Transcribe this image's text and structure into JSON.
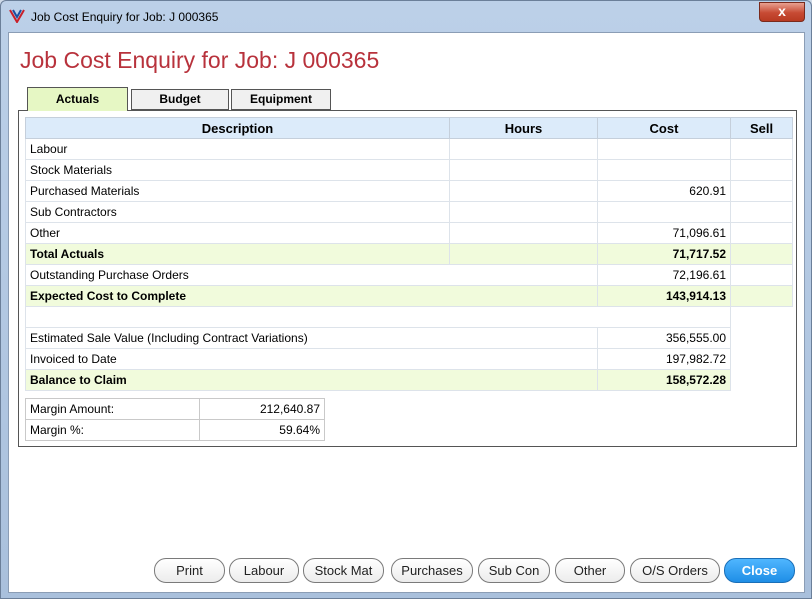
{
  "window": {
    "title": "Job Cost Enquiry for Job: J 000365",
    "close_glyph": "x"
  },
  "page": {
    "title": "Job Cost Enquiry for Job: J 000365"
  },
  "tabs": [
    {
      "label": "Actuals"
    },
    {
      "label": "Budget"
    },
    {
      "label": "Equipment"
    }
  ],
  "grid": {
    "headers": {
      "description": "Description",
      "hours": "Hours",
      "cost": "Cost",
      "sell": "Sell"
    },
    "rows": [
      {
        "description": "Labour",
        "hours": "",
        "cost": "",
        "sell": ""
      },
      {
        "description": "Stock Materials",
        "hours": "",
        "cost": "",
        "sell": ""
      },
      {
        "description": "Purchased Materials",
        "hours": "",
        "cost": "620.91",
        "sell": ""
      },
      {
        "description": "Sub Contractors",
        "hours": "",
        "cost": "",
        "sell": ""
      },
      {
        "description": "Other",
        "hours": "",
        "cost": "71,096.61",
        "sell": ""
      },
      {
        "description": "Total Actuals",
        "hours": "",
        "cost": "71,717.52",
        "sell": ""
      },
      {
        "description": "Outstanding Purchase Orders",
        "cost": "72,196.61"
      },
      {
        "description": "Expected Cost to Complete",
        "cost": "143,914.13"
      },
      {
        "description": "Estimated Sale Value (Including Contract Variations)",
        "cost": "356,555.00"
      },
      {
        "description": "Invoiced to Date",
        "cost": "197,982.72"
      },
      {
        "description": "Balance to Claim",
        "cost": "158,572.28"
      }
    ]
  },
  "margin": {
    "amount_label": "Margin Amount:",
    "amount_value": "212,640.87",
    "pct_label": "Margin %:",
    "pct_value": "59.64%"
  },
  "buttons": {
    "print": "Print",
    "labour": "Labour",
    "stock_mat": "Stock Mat",
    "purchases": "Purchases",
    "sub_con": "Sub Con",
    "other": "Other",
    "os_orders": "O/S Orders",
    "close": "Close"
  },
  "colors": {
    "title_red": "#b8323c",
    "active_tab": "#e6f7c4",
    "highlight_row": "#f1fbdc",
    "header_blue": "#dcebfa",
    "primary_button": "#1f8ee6"
  }
}
